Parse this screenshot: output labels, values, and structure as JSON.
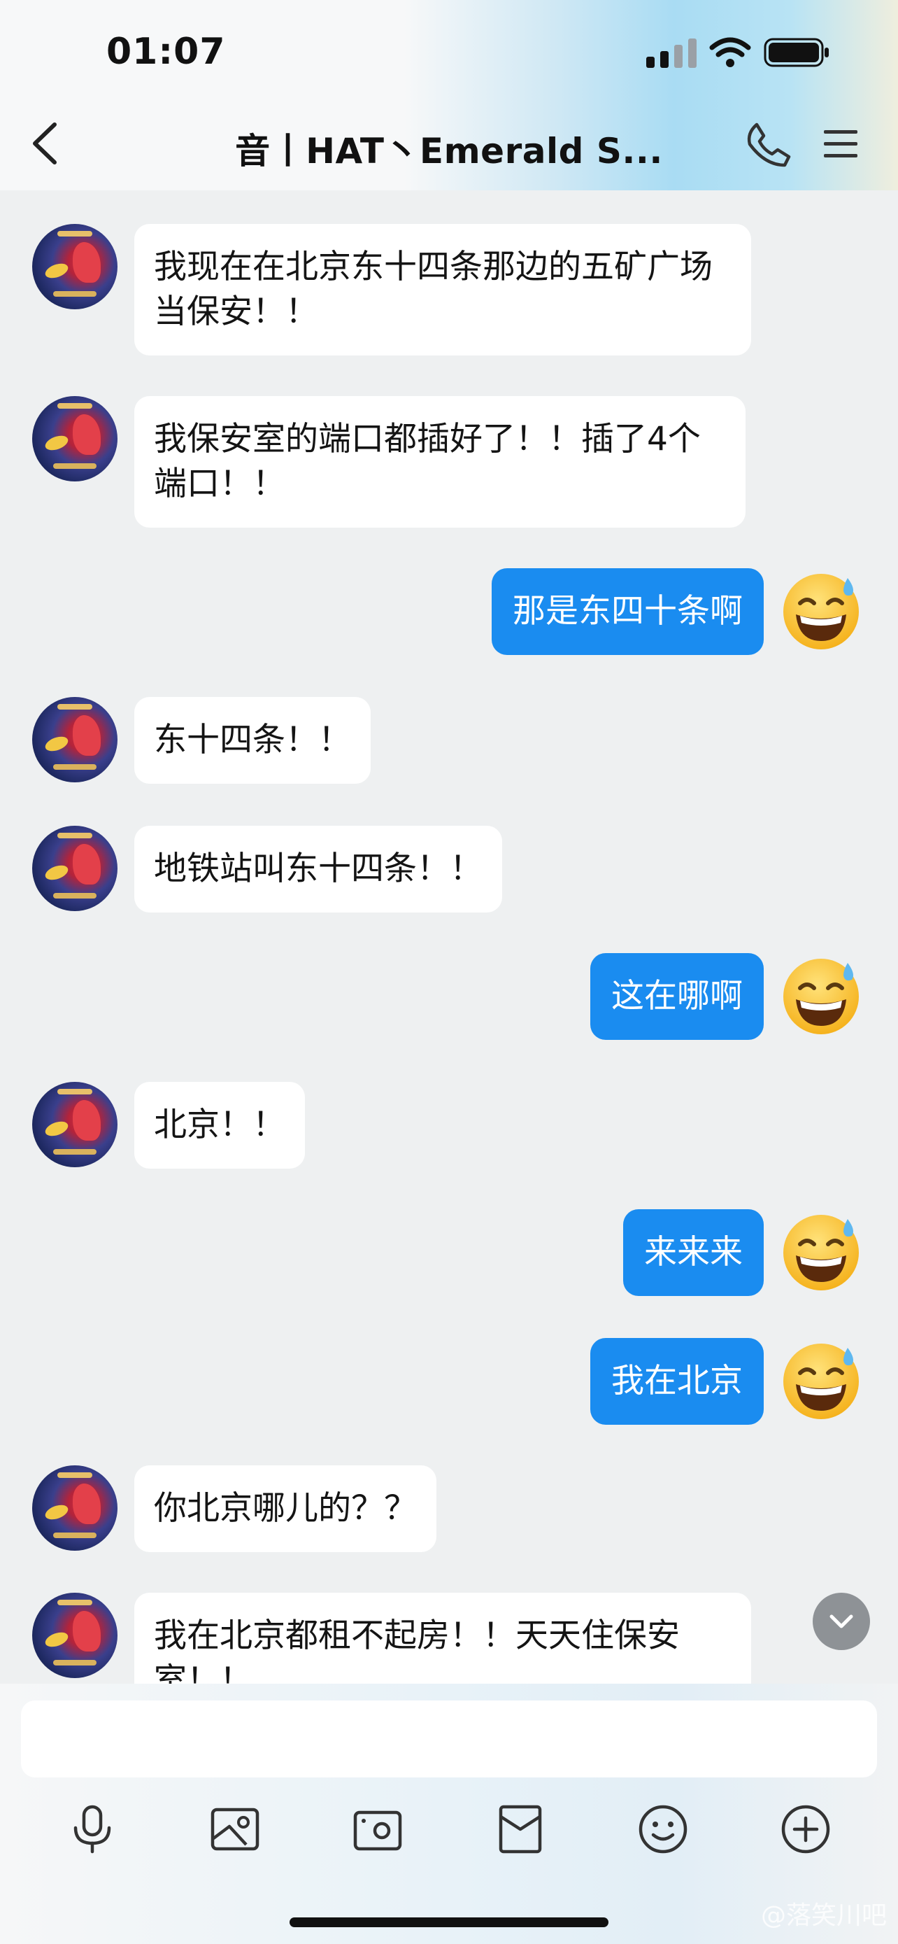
{
  "status_bar": {
    "time": "01:07"
  },
  "header": {
    "title": "音丨HAT丶Emerald S..."
  },
  "messages": [
    {
      "direction": "in",
      "text": "我现在在北京东十四条那边的五矿广场当保安！！"
    },
    {
      "direction": "in",
      "text": "我保安室的端口都插好了！！插了4个端口！！"
    },
    {
      "direction": "out",
      "text": "那是东四十条啊"
    },
    {
      "direction": "in",
      "text": "东十四条！！"
    },
    {
      "direction": "in",
      "text": "地铁站叫东十四条！！"
    },
    {
      "direction": "out",
      "text": "这在哪啊"
    },
    {
      "direction": "in",
      "text": "北京！！"
    },
    {
      "direction": "out",
      "text": "来来来"
    },
    {
      "direction": "out",
      "text": "我在北京"
    },
    {
      "direction": "in",
      "text": "你北京哪儿的？？"
    },
    {
      "direction": "in",
      "text": "我在北京都租不起房！！天天住保安室！！"
    }
  ],
  "input": {
    "value": "",
    "placeholder": ""
  },
  "toolbar": [
    "microphone-icon",
    "image-icon",
    "camera-icon",
    "red-packet-icon",
    "emoji-icon",
    "plus-icon"
  ],
  "watermark": "@落笑川吧",
  "colors": {
    "outgoing_bubble": "#1a8cf0",
    "incoming_bubble": "#ffffff",
    "background": "#eef0f1"
  }
}
